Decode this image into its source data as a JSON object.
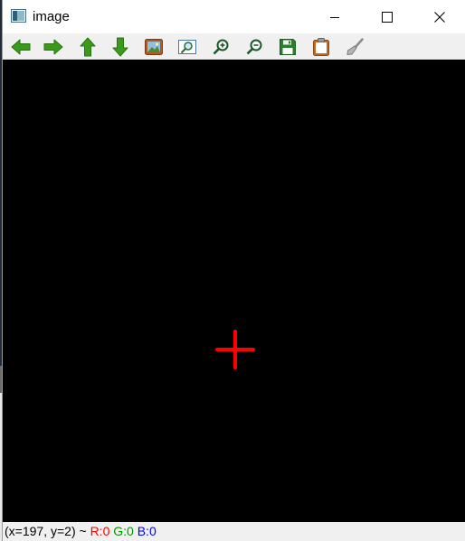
{
  "window": {
    "title": "image",
    "icon": "app-image-icon"
  },
  "title_buttons": [
    {
      "name": "minimize-button",
      "icon": "minimize-icon"
    },
    {
      "name": "maximize-button",
      "icon": "maximize-icon"
    },
    {
      "name": "close-button",
      "icon": "close-icon"
    }
  ],
  "toolbar": {
    "buttons": [
      {
        "name": "pan-left-button",
        "icon": "arrow-left-icon"
      },
      {
        "name": "pan-right-button",
        "icon": "arrow-right-icon"
      },
      {
        "name": "pan-up-button",
        "icon": "arrow-up-icon"
      },
      {
        "name": "pan-down-button",
        "icon": "arrow-down-icon"
      },
      {
        "name": "fit-image-button",
        "icon": "picture-icon"
      },
      {
        "name": "zoom-region-button",
        "icon": "zoom-region-icon"
      },
      {
        "name": "zoom-in-button",
        "icon": "zoom-in-icon"
      },
      {
        "name": "zoom-out-button",
        "icon": "zoom-out-icon"
      },
      {
        "name": "save-button",
        "icon": "save-icon"
      },
      {
        "name": "copy-clipboard-button",
        "icon": "clipboard-icon"
      },
      {
        "name": "properties-button",
        "icon": "brush-icon"
      }
    ]
  },
  "canvas": {
    "background": "#000000",
    "marker": {
      "shape": "cross",
      "color": "#ff0000"
    }
  },
  "status": {
    "coords": "(x=197, y=2) ~",
    "r": "R:0",
    "g": "G:0",
    "b": "B:0"
  },
  "colors": {
    "toolbar_arrow_green": "#3a9a1a",
    "marker_red": "#ff0000",
    "status_red": "#ff0000",
    "status_green": "#009900",
    "status_blue": "#0000ff"
  }
}
